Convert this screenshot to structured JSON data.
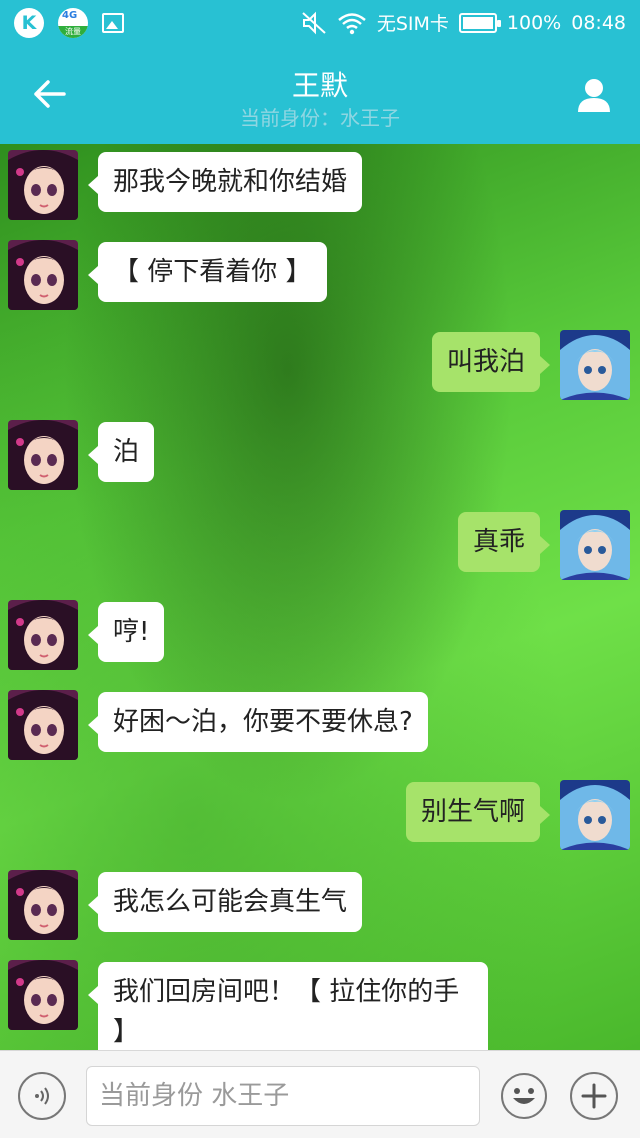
{
  "status_bar": {
    "k_label": "K",
    "network_label": "4G",
    "traffic_label": "流量",
    "sim_label": "无SIM卡",
    "battery_percent": "100%",
    "time": "08:48"
  },
  "header": {
    "title": "王默",
    "subtitle": "当前身份：水王子"
  },
  "messages": [
    {
      "side": "left",
      "text": "那我今晚就和你结婚"
    },
    {
      "side": "left",
      "text": "【 停下看着你 】"
    },
    {
      "side": "right",
      "text": "叫我泊"
    },
    {
      "side": "left",
      "text": "泊"
    },
    {
      "side": "right",
      "text": "真乖"
    },
    {
      "side": "left",
      "text": "哼!"
    },
    {
      "side": "left",
      "text": "好困～泊，你要不要休息?"
    },
    {
      "side": "right",
      "text": "别生气啊"
    },
    {
      "side": "left",
      "text": "我怎么可能会真生气"
    },
    {
      "side": "left",
      "text": "我们回房间吧！【 拉住你的手 】"
    }
  ],
  "input": {
    "placeholder": "当前身份 水王子"
  },
  "colors": {
    "header": "#28c1d3",
    "bubble_left": "#ffffff",
    "bubble_right": "#a6e36a"
  }
}
